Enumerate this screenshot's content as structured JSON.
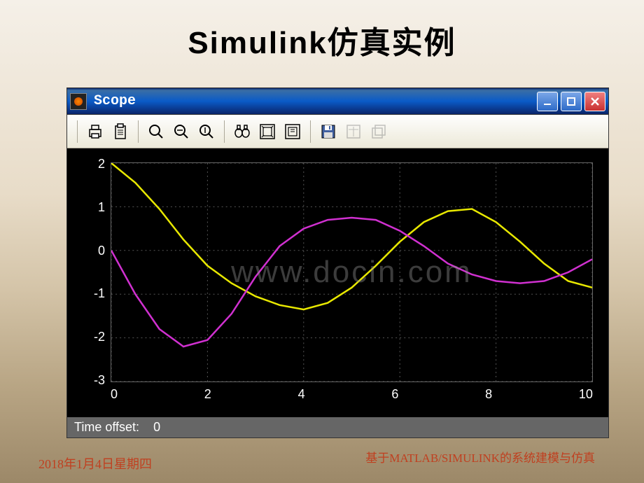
{
  "slide": {
    "title": "Simulink仿真实例",
    "date": "2018年1月4日星期四",
    "subtitle": "基于MATLAB/SIMULINK的系统建模与仿真"
  },
  "window": {
    "title": "Scope",
    "controls": {
      "minimize": "—",
      "maximize": "□",
      "close": "×"
    }
  },
  "toolbar": {
    "icons": [
      "print",
      "clipboard",
      "zoom-in",
      "zoom-x",
      "zoom-y",
      "binoculars",
      "autoscale",
      "save-config",
      "floppy",
      "params",
      "restore"
    ]
  },
  "scope": {
    "time_offset_label": "Time offset:",
    "time_offset_value": "0",
    "y_ticks": [
      "2",
      "1",
      "0",
      "-1",
      "-2",
      "-3"
    ],
    "x_ticks": [
      "0",
      "2",
      "4",
      "6",
      "8",
      "10"
    ],
    "watermark": "www.docin.com"
  },
  "chart_data": {
    "type": "line",
    "xlabel": "",
    "ylabel": "",
    "xlim": [
      0,
      10
    ],
    "ylim": [
      -3,
      2
    ],
    "series": [
      {
        "name": "signal-yellow",
        "color": "#e8e800",
        "x": [
          0,
          0.5,
          1,
          1.5,
          2,
          2.5,
          3,
          3.5,
          4,
          4.5,
          5,
          5.5,
          6,
          6.5,
          7,
          7.5,
          8,
          8.5,
          9,
          9.5,
          10
        ],
        "values": [
          2.0,
          1.55,
          0.95,
          0.25,
          -0.35,
          -0.75,
          -1.05,
          -1.25,
          -1.35,
          -1.2,
          -0.85,
          -0.35,
          0.2,
          0.65,
          0.9,
          0.95,
          0.65,
          0.2,
          -0.3,
          -0.7,
          -0.85
        ]
      },
      {
        "name": "signal-magenta",
        "color": "#d030d0",
        "x": [
          0,
          0.5,
          1,
          1.5,
          2,
          2.5,
          3,
          3.5,
          4,
          4.5,
          5,
          5.5,
          6,
          6.5,
          7,
          7.5,
          8,
          8.5,
          9,
          9.5,
          10
        ],
        "values": [
          0.0,
          -1.0,
          -1.8,
          -2.2,
          -2.05,
          -1.45,
          -0.6,
          0.1,
          0.5,
          0.7,
          0.75,
          0.7,
          0.45,
          0.1,
          -0.3,
          -0.55,
          -0.7,
          -0.75,
          -0.7,
          -0.5,
          -0.2
        ]
      }
    ]
  }
}
